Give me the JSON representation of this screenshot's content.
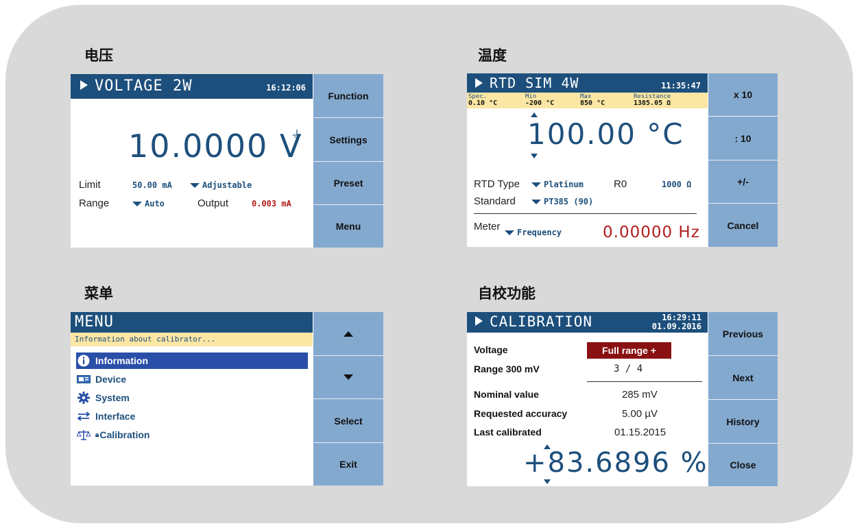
{
  "titles": {
    "voltage": "电压",
    "temperature": "温度",
    "menu": "菜单",
    "calibration": "自校功能"
  },
  "voltage": {
    "header": "VOLTAGE 2W",
    "time": "16:12:06",
    "reading": "10.0000 V",
    "limit_label": "Limit",
    "limit_value": "50.00 mA",
    "limit_mode": "Adjustable",
    "range_label": "Range",
    "range_value": "Auto",
    "output_label": "Output",
    "output_value": "0.003 mA",
    "buttons": [
      "Function",
      "Settings",
      "Preset",
      "Menu"
    ]
  },
  "temperature": {
    "header": "RTD SIM 4W",
    "time": "11:35:47",
    "spec_label": "Spec.",
    "spec_value": "0.10 °C",
    "min_label": "Min",
    "min_value": "-200 °C",
    "max_label": "Max",
    "max_value": "850 °C",
    "res_label": "Resistance",
    "res_value": "1385.05 Ω",
    "reading": "100.00 °C",
    "rtd_type_label": "RTD Type",
    "rtd_type_value": "Platinum",
    "r0_label": "R0",
    "r0_value": "1000 Ω",
    "standard_label": "Standard",
    "standard_value": "PT385 (90)",
    "meter_label": "Meter",
    "meter_value": "Frequency",
    "meter_reading": "0.00000 Hz",
    "buttons": [
      "x 10",
      ": 10",
      "+/-",
      "Cancel"
    ]
  },
  "menu": {
    "header": "MENU",
    "info_bar": "Information about calibrator...",
    "items": [
      "Information",
      "Device",
      "System",
      "Interface",
      "Calibration"
    ],
    "selected_index": 0,
    "buttons": [
      "▲",
      "▼",
      "Select",
      "Exit"
    ]
  },
  "calibration": {
    "header": "CALIBRATION",
    "time": "16:29:11",
    "date": "01.09.2016",
    "voltage_label": "Voltage",
    "voltage_value": "Full range +",
    "range_label": "Range 300 mV",
    "range_value": "3 / 4",
    "nominal_label": "Nominal value",
    "nominal_value": "285 mV",
    "accuracy_label": "Requested accuracy",
    "accuracy_value": "5.00 µV",
    "last_label": "Last calibrated",
    "last_value": "01.15.2015",
    "reading": "+83.6896 %",
    "buttons": [
      "Previous",
      "Next",
      "History",
      "Close"
    ]
  },
  "colors": {
    "header": "#1d4f7c",
    "side": "#84a9cf",
    "info_bar": "#fbe6a4",
    "red": "#b11d1d",
    "selected": "#2a4fa8"
  }
}
